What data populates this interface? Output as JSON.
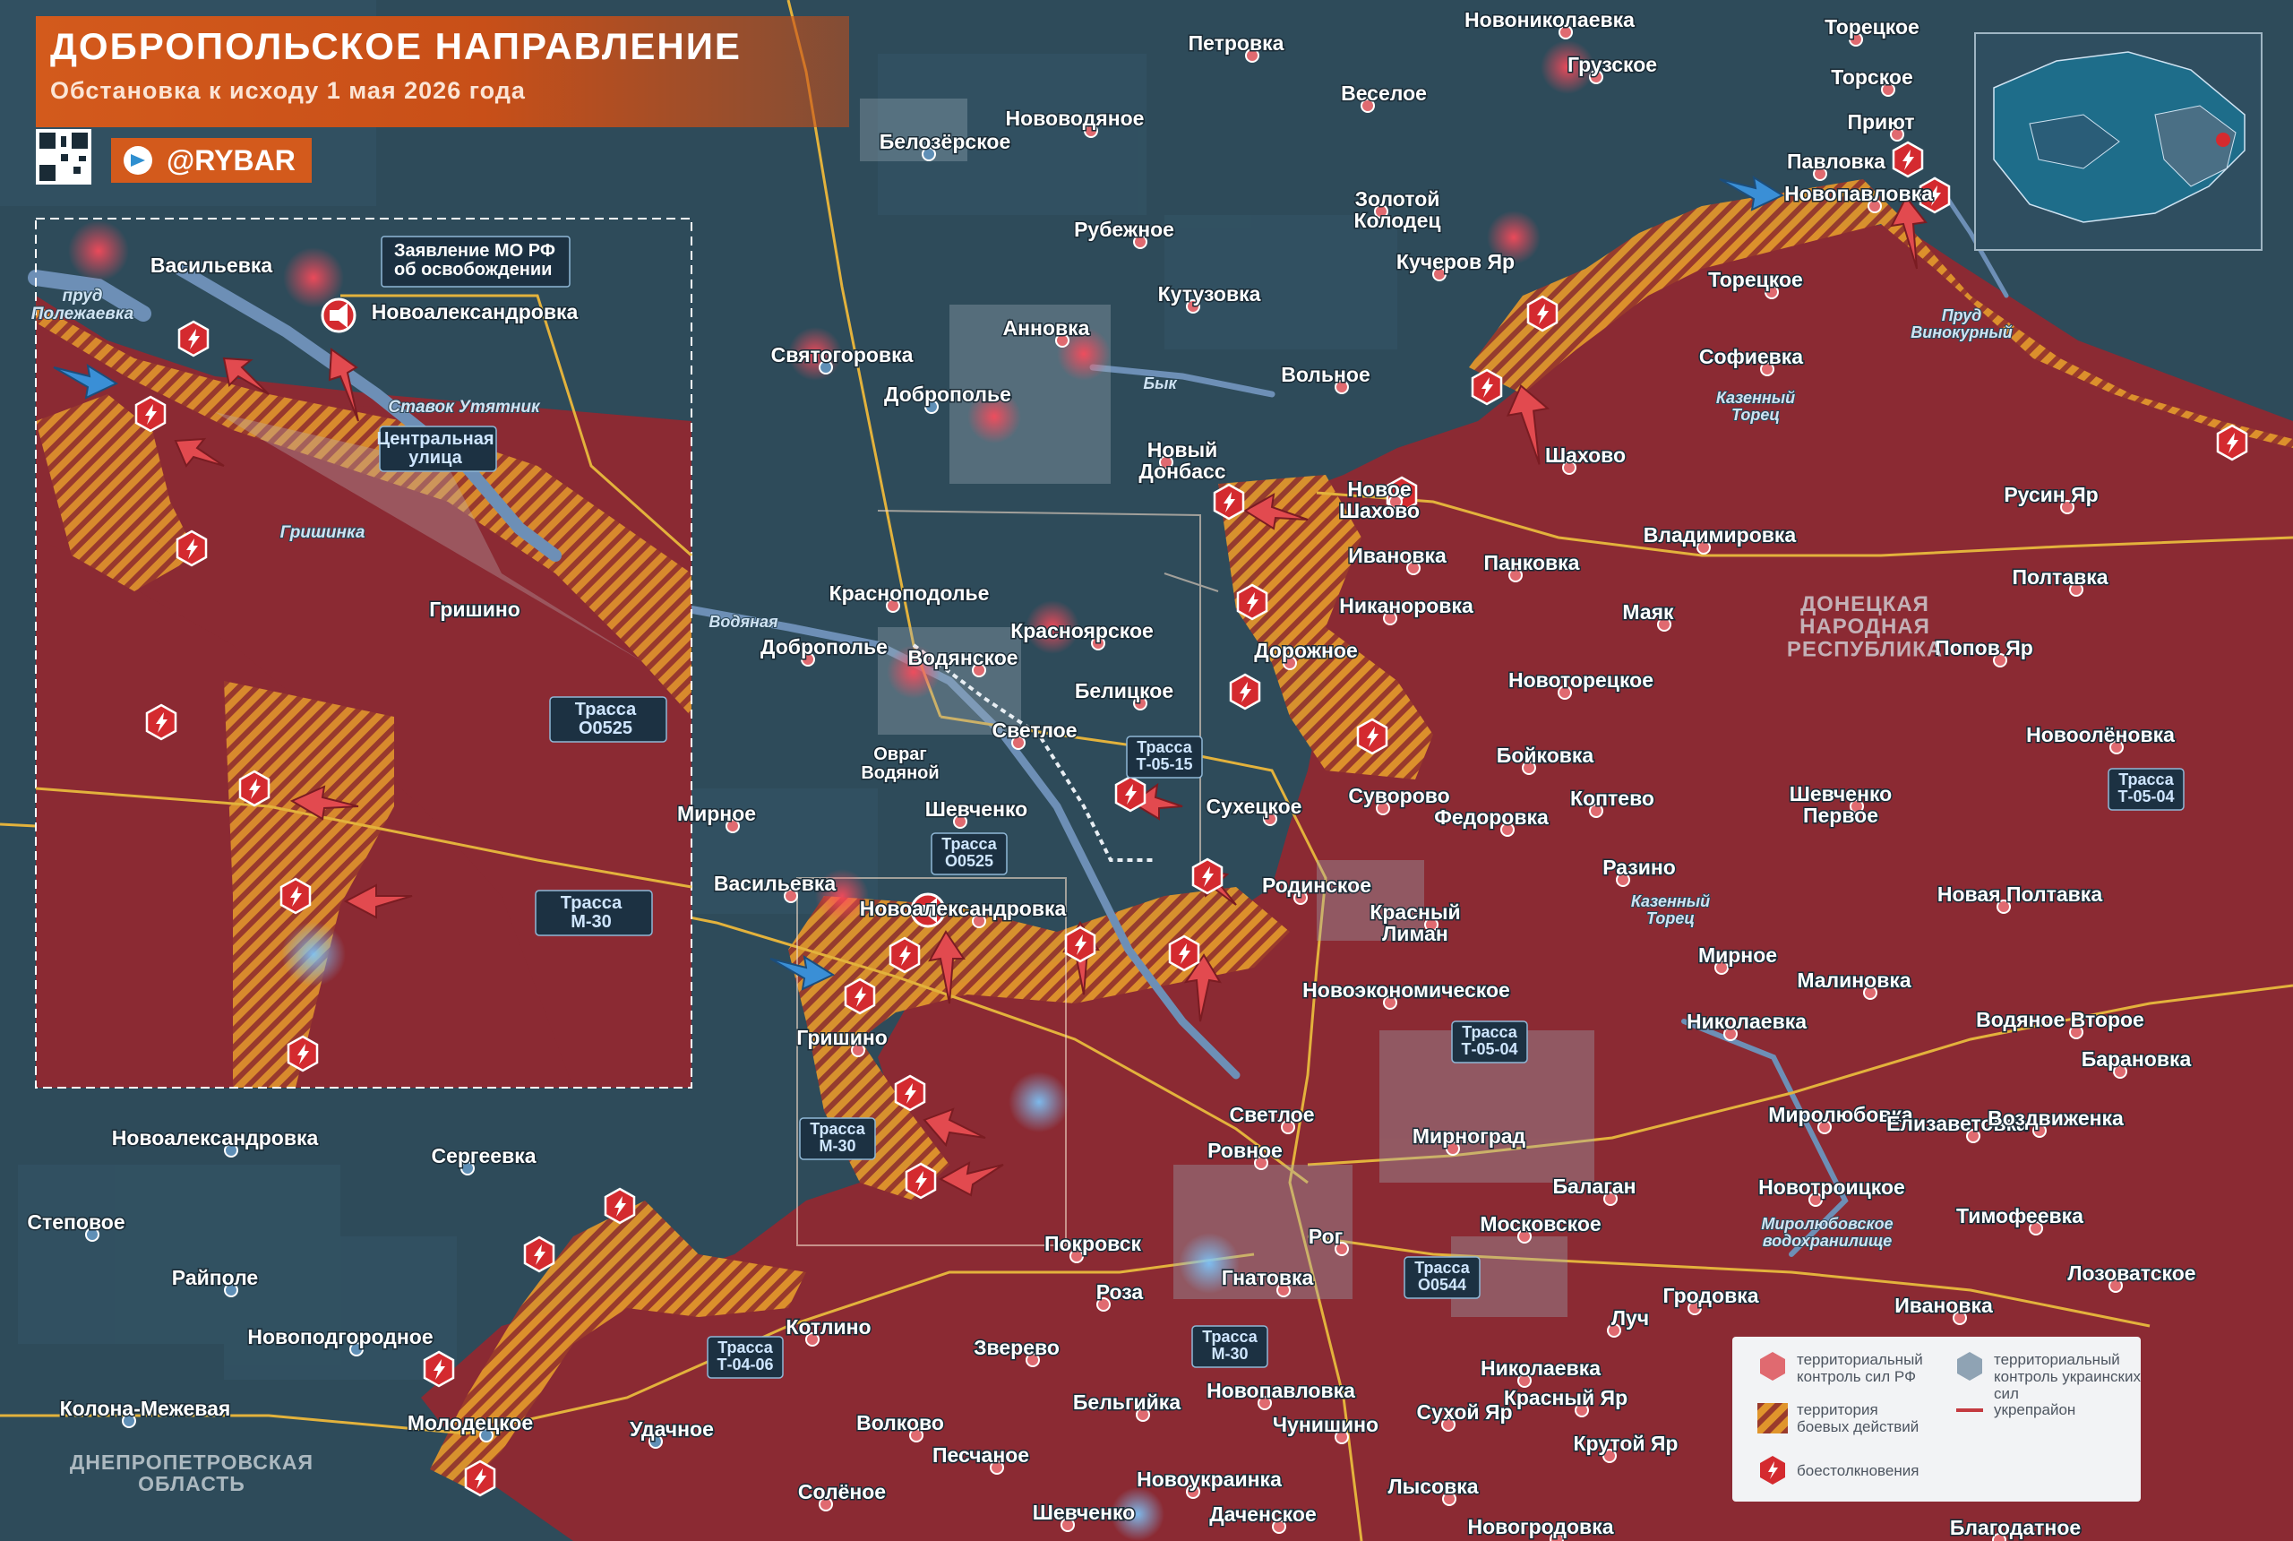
{
  "header": {
    "title": "ДОБРОПОЛЬСКОЕ НАПРАВЛЕНИЕ",
    "subtitle": "Обстановка к исходу 1 мая 2026 года",
    "brand": "@RYBAR"
  },
  "colors": {
    "ru_control": "#8b2a33",
    "ua_control": "#2e4b5a",
    "combat_zone": "#e0952c",
    "brand_orange": "#d35a1c",
    "clash_marker": "#d42a2f",
    "road": "#e3b23c"
  },
  "icons": [
    "qr-code-icon",
    "telegram-icon",
    "clash-marker-icon",
    "attack-arrow-icon",
    "megaphone-icon",
    "city-marker-icon"
  ],
  "inset": {
    "annotation": "Заявление МО РФ\nоб освобождении",
    "labels": {
      "vasilevka": "Васильевка",
      "pond": "пруд\nПолежаевка",
      "novoaleksandrovka": "Новоалександровка",
      "stavok": "Ставок Утятник",
      "central_street": "Центральная\nулица",
      "grishinka": "Гришинка",
      "grishino": "Гришино",
      "road_o0525": "Трасса\nО0525",
      "road_m30": "Трасса\nМ-30"
    }
  },
  "towns": [
    "Новониколаевка",
    "Торецкое",
    "Петровка",
    "Грузское",
    "Торское",
    "Веселое",
    "Нововодяное",
    "Белозёрское",
    "Приют",
    "Павловка",
    "Новопавловка",
    "Золотой\nКолодец",
    "Рубежное",
    "Кучеров Яр",
    "Торецкое",
    "Кутузовка",
    "Софиевка",
    "Святогоровка",
    "Анновка",
    "Доброполье",
    "Вольное",
    "Шахово",
    "Русин Яр",
    "Новый\nДонбасс",
    "Новое\nШахово",
    "Владимировка",
    "Ивановка",
    "Панковка",
    "Полтавка",
    "Краснoподолье",
    "Красноярское",
    "Никаноровка",
    "Маяк",
    "Доброполье",
    "Водянское",
    "Дорожное",
    "Попов Яр",
    "Новоторецкое",
    "Белицкое",
    "Светлое",
    "Новоолёновка",
    "Бойковка",
    "Мирное",
    "Шевченко",
    "Сухецкое",
    "Суворово",
    "Федоровка",
    "Коптево",
    "Шевченко\nПервое",
    "Разино",
    "Васильевка",
    "Родинское",
    "Красный\nЛиман",
    "Новая Полтавка",
    "Новоалександровка",
    "Мирное",
    "Малиновка",
    "Новоэкономическое",
    "Водяное Второе",
    "Николаевка",
    "Гришино",
    "Барановка",
    "Светлое",
    "Миролюбовка",
    "Елизаветовка",
    "Воздвиженка",
    "Новоалександровка",
    "Мирноград",
    "Ровное",
    "Сергеевка",
    "Балаган",
    "Новотроицкое",
    "Степовое",
    "Московское",
    "Тимофеевка",
    "Покровск",
    "Рог",
    "Роза",
    "Гнатовка",
    "Лозоватское",
    "Райполе",
    "Гродовка",
    "Ивановка",
    "Котлино",
    "Зверево",
    "Луч",
    "Новоподгородное",
    "Николаевка",
    "Бельгийка",
    "Новопавловка",
    "Красный Яр",
    "Колона-Межевая",
    "Молодецкое",
    "Сухой Яр",
    "Чунишино",
    "Удачное",
    "Волково",
    "Крутой Яр",
    "Песчаное",
    "Новоукраинка",
    "Лысовка",
    "Солёное",
    "Даченское",
    "Шевченко",
    "Новогродовка",
    "Благодатное"
  ],
  "water_labels": [
    "Водяная",
    "Бык",
    "Пруд\nВинокурный",
    "Казенный\nТорец",
    "Казенный\nТорец",
    "Миролюбовское\nводохранилище",
    "Овраг\nВодяной"
  ],
  "regions": {
    "dnr": "ДОНЕЦКАЯ\nНАРОДНАЯ\nРЕСПУБЛИКА",
    "dnepr": "ДНЕПРОПЕТРОВСКАЯ\nОБЛАСТЬ"
  },
  "roads": [
    {
      "label": "Трасса\nО0525"
    },
    {
      "label": "Трасса\nТ-05-15"
    },
    {
      "label": "Трасса\nТ-05-04"
    },
    {
      "label": "Трасса\nТ-05-04"
    },
    {
      "label": "Трасса\nМ-30"
    },
    {
      "label": "Трасса\nМ-30"
    },
    {
      "label": "Трасса\nО0544"
    },
    {
      "label": "Трасса\nТ-04-06"
    }
  ],
  "legend": {
    "ru_control": "территориальный\nконтроль сил РФ",
    "ua_control": "территориальный\nконтроль украинских сил",
    "combat_zone": "территория\nбоевых действий",
    "fortified": "укрепрайон",
    "clashes": "боестолкновения"
  }
}
